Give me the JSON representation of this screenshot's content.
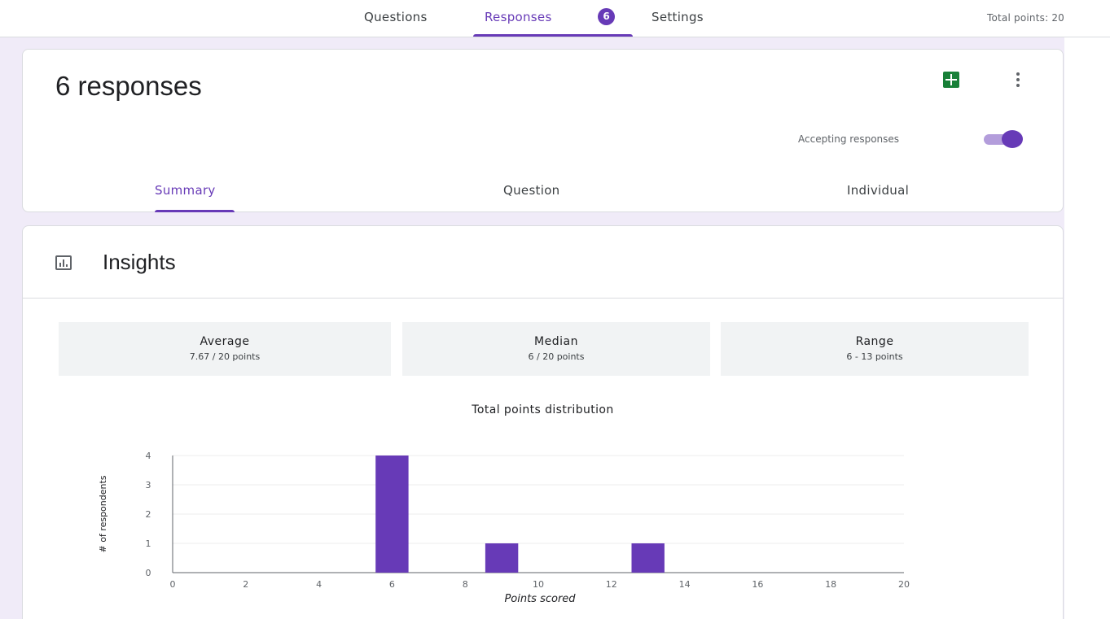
{
  "nav": {
    "tabs": [
      {
        "label": "Questions"
      },
      {
        "label": "Responses"
      },
      {
        "label": "Settings"
      }
    ],
    "badge": "6",
    "total_points": "Total points: 20"
  },
  "responses_card": {
    "title": "6 responses",
    "accepting_label": "Accepting responses",
    "accepting_on": true,
    "subtabs": [
      {
        "label": "Summary"
      },
      {
        "label": "Question"
      },
      {
        "label": "Individual"
      }
    ]
  },
  "insights": {
    "title": "Insights",
    "stats": [
      {
        "label": "Average",
        "value": "7.67 / 20 points"
      },
      {
        "label": "Median",
        "value": "6 / 20 points"
      },
      {
        "label": "Range",
        "value": "6 - 13 points"
      }
    ]
  },
  "colors": {
    "accent": "#673ab7",
    "background": "#f0ebf8"
  },
  "chart_data": {
    "type": "bar",
    "title": "Total points distribution",
    "xlabel": "Points scored",
    "ylabel": "# of respondents",
    "xlim": [
      0,
      20
    ],
    "ylim": [
      0,
      4
    ],
    "x_ticks": [
      "0",
      "2",
      "4",
      "6",
      "8",
      "10",
      "12",
      "14",
      "16",
      "18",
      "20"
    ],
    "y_ticks": [
      "0",
      "1",
      "2",
      "3",
      "4"
    ],
    "bars": [
      {
        "x": 6,
        "value": 4
      },
      {
        "x": 9,
        "value": 1
      },
      {
        "x": 13,
        "value": 1
      }
    ],
    "color": "#673ab7",
    "grid": true
  }
}
